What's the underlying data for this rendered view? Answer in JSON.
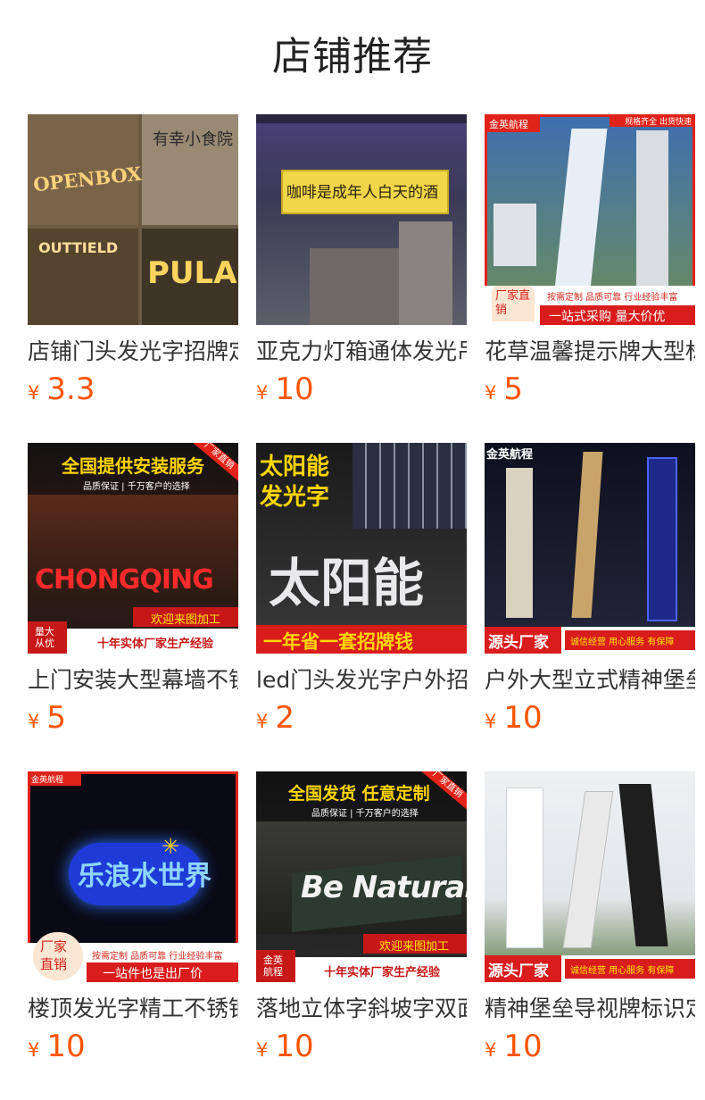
{
  "page": {
    "title": "店铺推荐"
  },
  "currency": "¥",
  "products": [
    {
      "name": "店铺门头发光字招牌定制",
      "price": "3.3",
      "image_text": [
        "OPENBOX",
        "有幸小食院",
        "OUTTIELD",
        "PULA"
      ]
    },
    {
      "name": "亚克力灯箱通体发光吊牌",
      "price": "10",
      "image_text": [
        "咖啡是成年人白天的酒"
      ]
    },
    {
      "name": "花草温馨提示牌大型标识",
      "price": "5",
      "image_text": [
        "金英航程",
        "规格齐全 出货快速",
        "厂家直销",
        "按需定制 品质可靠 行业经验丰富",
        "一站式采购 量大价优"
      ]
    },
    {
      "name": "上门安装大型幕墙不锈钢",
      "price": "5",
      "image_text": [
        "全国提供安装服务",
        "品质保证 | 千万客户的选择",
        "CHONGQING",
        "欢迎来图加工",
        "量大从优",
        "十年实体厂家生产经验"
      ]
    },
    {
      "name": "led门头发光字户外招牌",
      "price": "2",
      "image_text": [
        "太阳能",
        "发光字",
        "太阳能",
        "一年省一套招牌钱"
      ]
    },
    {
      "name": "户外大型立式精神堡垒",
      "price": "10",
      "image_text": [
        "金英航程",
        "源头厂家",
        "诚信经营 用心服务 有保障"
      ]
    },
    {
      "name": "楼顶发光字精工不锈钢",
      "price": "10",
      "image_text": [
        "金英航程",
        "乐浪水世界",
        "厂家直销",
        "按需定制 品质可靠 行业经验丰富",
        "一站件也是出厂价"
      ]
    },
    {
      "name": "落地立体字斜坡字双面",
      "price": "10",
      "image_text": [
        "全国发货 任意定制",
        "品质保证 | 千万客户的选择",
        "Be Natural",
        "欢迎来图加工",
        "金英航程",
        "十年实体厂家生产经验"
      ]
    },
    {
      "name": "精神堡垒导视牌标识定制",
      "price": "10",
      "image_text": [
        "源头厂家",
        "诚信经营 用心服务 有保障"
      ]
    }
  ]
}
